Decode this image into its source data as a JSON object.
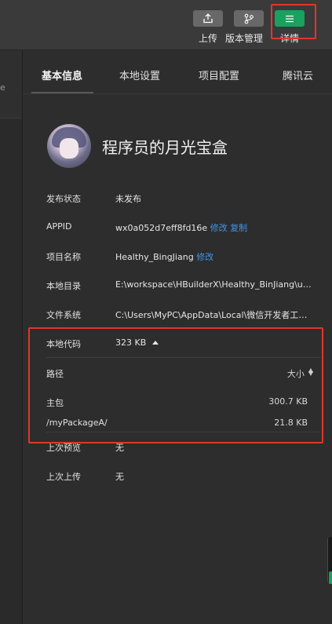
{
  "toolbar": {
    "upload_label": "上传",
    "version_label": "版本管理",
    "details_label": "详情",
    "upload_icon": "upload-icon",
    "version_icon": "branch-icon",
    "details_icon": "menu-icon",
    "accent_color": "#19a15f"
  },
  "left_pane": {
    "fragment": "e"
  },
  "tabs": [
    {
      "label": "基本信息"
    },
    {
      "label": "本地设置"
    },
    {
      "label": "项目配置"
    },
    {
      "label": "腾讯云"
    }
  ],
  "profile": {
    "name": "程序员的月光宝盒"
  },
  "info": {
    "publish_status": {
      "key": "发布状态",
      "value": "未发布"
    },
    "appid": {
      "key": "APPID",
      "value": "wx0a052d7eff8fd16e",
      "edit": "修改",
      "copy": "复制"
    },
    "project_name": {
      "key": "项目名称",
      "value": "Healthy_BingJiang",
      "edit": "修改"
    },
    "local_dir": {
      "key": "本地目录",
      "value": "E:\\workspace\\HBuilderX\\Healthy_BinJiang\\un..."
    },
    "file_system": {
      "key": "文件系统",
      "value": "C:\\Users\\MyPC\\AppData\\Local\\微信开发者工具..."
    },
    "local_code": {
      "key": "本地代码",
      "value": "323 KB",
      "table": {
        "col_path": "路径",
        "col_size": "大小",
        "rows": [
          {
            "path": "主包",
            "size": "300.7 KB"
          },
          {
            "path": "/myPackageA/",
            "size": "21.8 KB"
          }
        ]
      }
    },
    "last_preview": {
      "key": "上次预览",
      "value": "无"
    },
    "last_upload": {
      "key": "上次上传",
      "value": "无"
    }
  },
  "highlight_color": "#e0362b",
  "link_color": "#3f95e9"
}
